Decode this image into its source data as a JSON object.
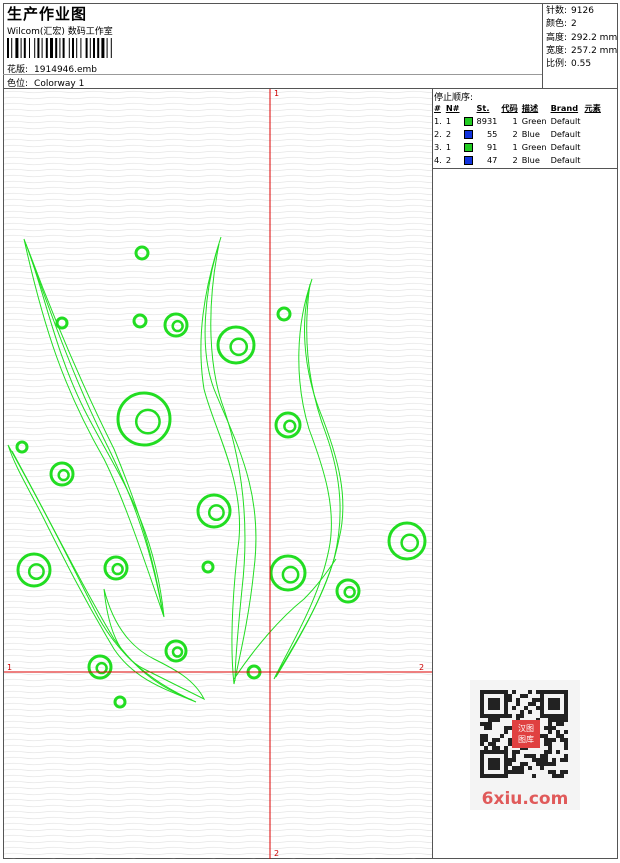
{
  "header": {
    "title": "生产作业图",
    "company": "Wilcom(汇宏) 数码工作室",
    "design_label": "花版:",
    "design_value": "1914946.emb",
    "colorway_label": "色位:",
    "colorway_value": "Colorway 1"
  },
  "stats": [
    {
      "label": "针数:",
      "value": "9126"
    },
    {
      "label": "颜色:",
      "value": "2"
    },
    {
      "label": "高度:",
      "value": "292.2 mm"
    },
    {
      "label": "宽度:",
      "value": "257.2 mm"
    },
    {
      "label": "比例:",
      "value": "0.55"
    }
  ],
  "sequence": {
    "title": "停止顺序:",
    "columns": [
      "#",
      "N#",
      "St.",
      "代码",
      "描述",
      "Brand",
      "元素"
    ],
    "rows": [
      {
        "idx": "1.",
        "n": "1",
        "color": "#22cc22",
        "st": "8931",
        "code": "1",
        "desc": "Green",
        "brand": "Default"
      },
      {
        "idx": "2.",
        "n": "2",
        "color": "#1133dd",
        "st": "55",
        "code": "2",
        "desc": "Blue",
        "brand": "Default"
      },
      {
        "idx": "3.",
        "n": "1",
        "color": "#22cc22",
        "st": "91",
        "code": "1",
        "desc": "Green",
        "brand": "Default"
      },
      {
        "idx": "4.",
        "n": "2",
        "color": "#1133dd",
        "st": "47",
        "code": "2",
        "desc": "Blue",
        "brand": "Default"
      }
    ]
  },
  "axes": {
    "top": "1",
    "bottom": "2",
    "left": "1",
    "right": "2"
  },
  "colors": {
    "stitch": "#22dd22",
    "axis": "#dd0000",
    "border": "#555555"
  },
  "watermark": {
    "text": "6xiu.com",
    "stamp": "汉图图库"
  }
}
